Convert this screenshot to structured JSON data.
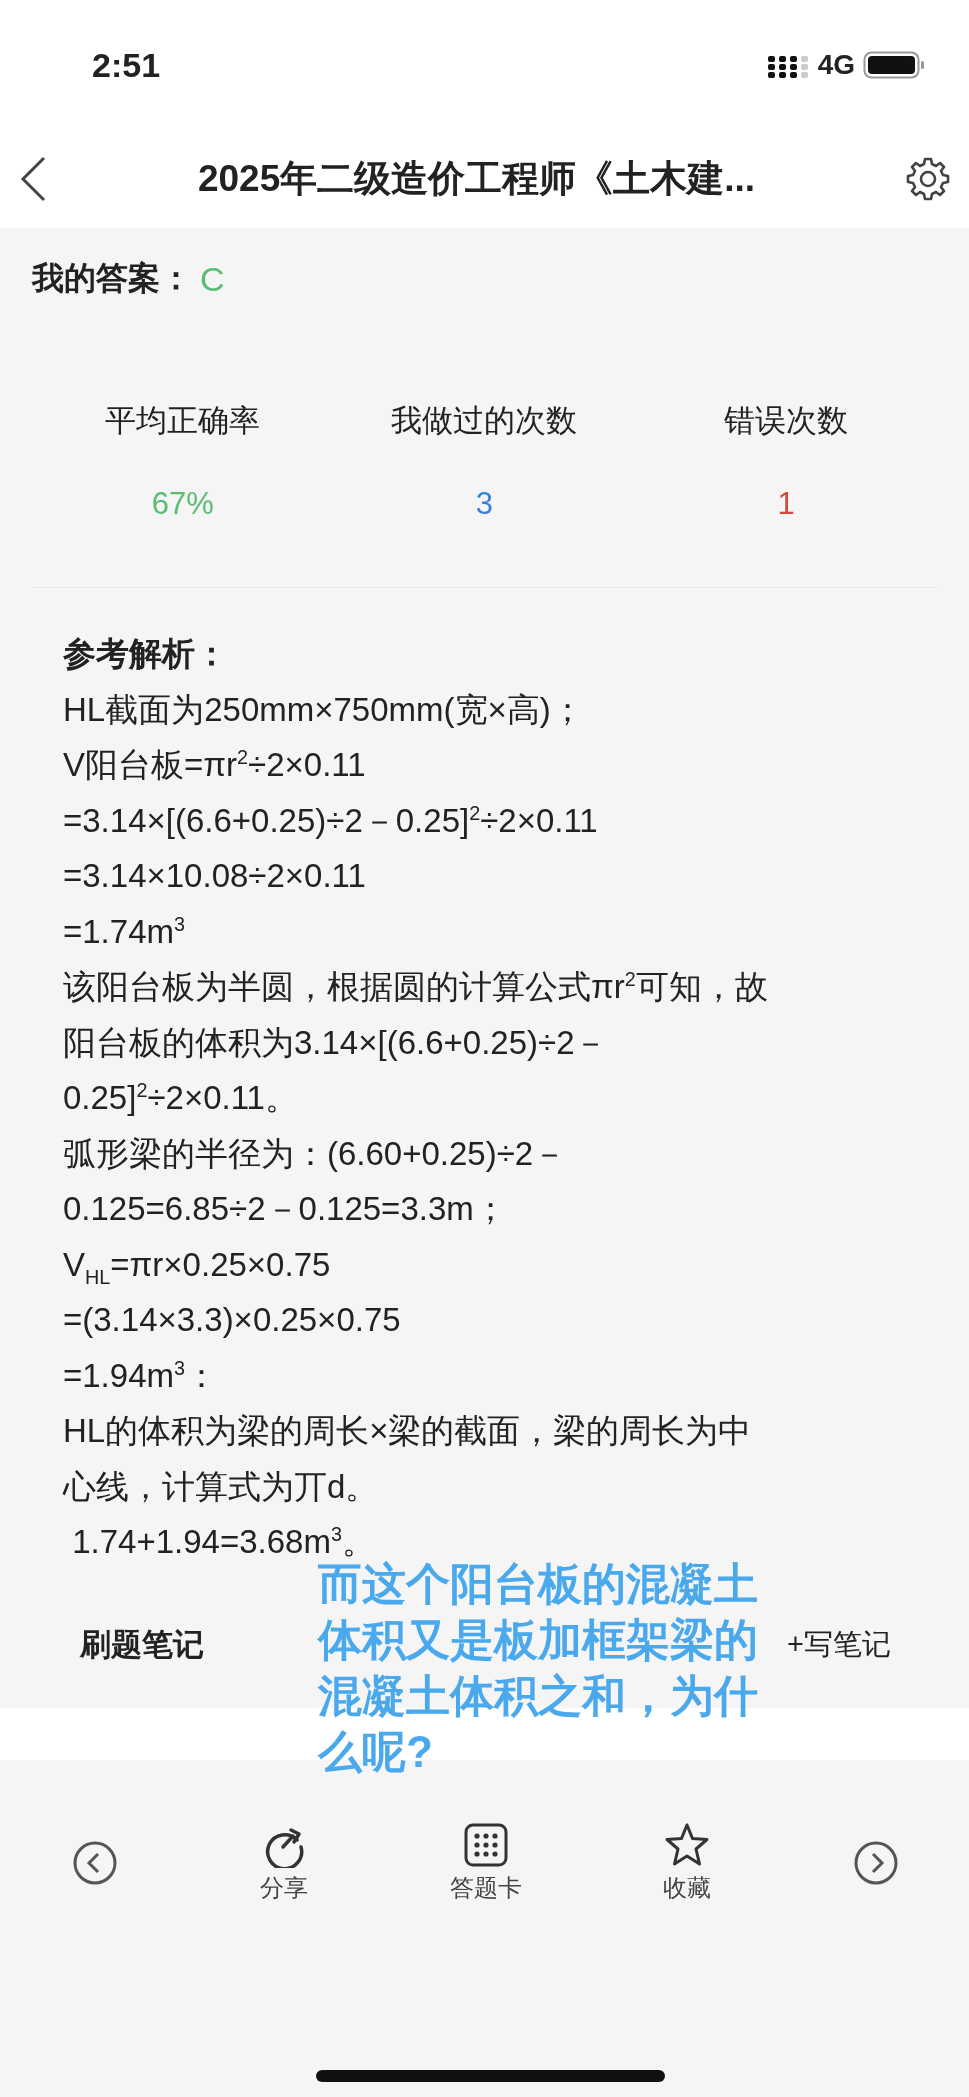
{
  "status_bar": {
    "time": "2:51",
    "network": "4G"
  },
  "nav": {
    "title": "2025年二级造价工程师《土木建..."
  },
  "my_answer": {
    "label": "我的答案：",
    "value": "C",
    "color": "#5bbd72"
  },
  "stats": [
    {
      "label": "平均正确率",
      "value": "67%",
      "color": "#5bbd72"
    },
    {
      "label": "我做过的次数",
      "value": "3",
      "color": "#3a7fe0"
    },
    {
      "label": "错误次数",
      "value": "1",
      "color": "#d14a3c"
    }
  ],
  "explanation": {
    "title": "参考解析：",
    "lines": [
      "HL截面为250mm×750mm(宽×高)；",
      "V阳台板=πr$^{2}$÷2×0.11",
      "=3.14×[(6.6+0.25)÷2－0.25]$^{2}$÷2×0.11",
      "=3.14×10.08÷2×0.11",
      "=1.74m$^{3}$",
      "该阳台板为半圆，根据圆的计算公式πr$^{2}$可知，故",
      "阳台板的体积为3.14×[(6.6+0.25)÷2－",
      "0.25]$^{2}$÷2×0.11。",
      "弧形梁的半径为：(6.60+0.25)÷2－",
      "0.125=6.85÷2－0.125=3.3m；",
      "V$_{HL}$=πr×0.25×0.75",
      "=(3.14×3.3)×0.25×0.75",
      "=1.94m$^{3}$：",
      "HL的体积为梁的周长×梁的截面，梁的周长为中",
      "心线，计算式为丌d。",
      " 1.74+1.94=3.68m$^{3}$。"
    ]
  },
  "notes": {
    "title": "刷题笔记",
    "action": "+写笔记"
  },
  "annotation": "而这个阳台板的混凝土体积又是板加框架梁的混凝土体积之和，为什么呢?",
  "toolbar": [
    {
      "kind": "prev"
    },
    {
      "kind": "share",
      "label": "分享"
    },
    {
      "kind": "card",
      "label": "答题卡"
    },
    {
      "kind": "favorite",
      "label": "收藏"
    },
    {
      "kind": "next"
    }
  ]
}
